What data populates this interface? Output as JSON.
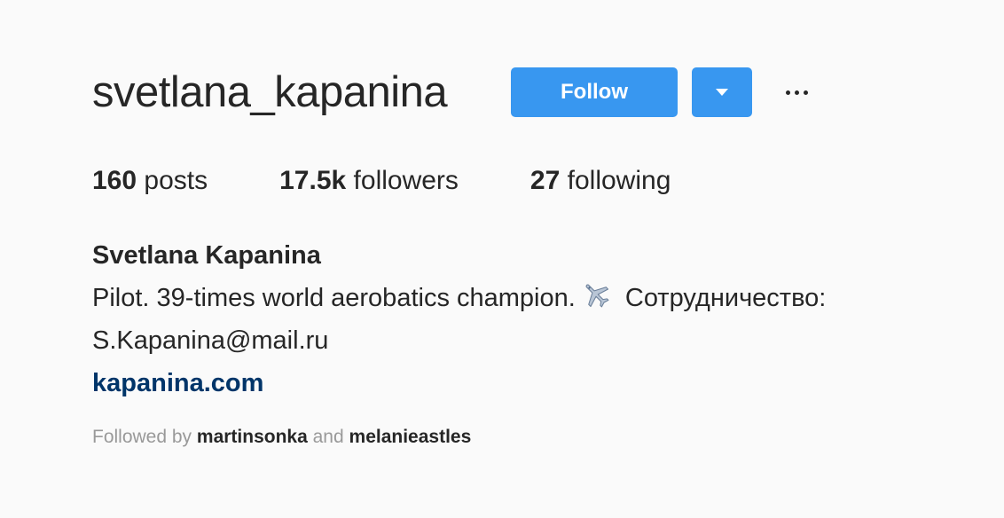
{
  "profile": {
    "username": "svetlana_kapanina",
    "full_name": "Svetlana Kapanina",
    "bio_part1": "Pilot. 39-times world aerobatics champion.",
    "bio_icon": "airplane-icon",
    "bio_part2": "Сотрудничество:",
    "bio_email": "S.Kapanina@mail.ru",
    "website": "kapanina.com"
  },
  "actions": {
    "follow_label": "Follow",
    "dropdown_icon": "caret-down-icon",
    "more_icon": "more-options-icon"
  },
  "stats": {
    "posts_count": "160",
    "posts_label": "posts",
    "followers_count": "17.5k",
    "followers_label": "followers",
    "following_count": "27",
    "following_label": "following"
  },
  "followed_by": {
    "prefix": "Followed by",
    "user1": "martinsonka",
    "conjunction": "and",
    "user2": "melanieastles"
  },
  "colors": {
    "accent": "#3897f0",
    "link": "#003569",
    "text": "#262626",
    "muted": "#999999",
    "background": "#fafafa"
  }
}
